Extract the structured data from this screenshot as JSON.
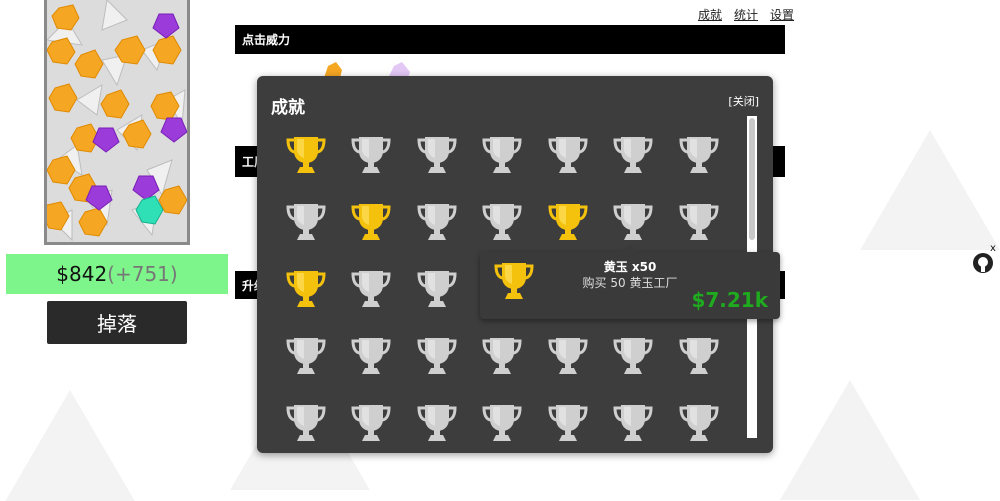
{
  "nav": {
    "achievements": "成就",
    "stats": "统计",
    "settings": "设置"
  },
  "money": {
    "amount": "$842",
    "increment": "(+751)"
  },
  "drop_button": "掉落",
  "sections": {
    "click_power": "点击威力",
    "factories_partial": "工厂",
    "upgrades_partial": "升级"
  },
  "dialog": {
    "title": "成就",
    "close": "[关闭]",
    "trophies": [
      "gold",
      "silver",
      "silver",
      "silver",
      "silver",
      "silver",
      "silver",
      "silver",
      "gold",
      "silver",
      "silver",
      "gold",
      "silver",
      "silver",
      "gold",
      "silver",
      "silver",
      "silver",
      "silver",
      "silver",
      "silver",
      "silver",
      "silver",
      "silver",
      "silver",
      "silver",
      "silver",
      "silver",
      "silver",
      "silver",
      "silver",
      "silver",
      "silver",
      "silver",
      "silver"
    ]
  },
  "tooltip": {
    "name": "黄玉 x50",
    "description": "购买 50 黄玉工厂",
    "price": "$7.21k"
  },
  "colors": {
    "gold": "#f4c20d",
    "silver": "#cfcfcf",
    "money_bar": "#7df58a",
    "price": "#1faa1f"
  },
  "icons": {
    "trophy": "trophy-icon",
    "github": "github-icon"
  }
}
